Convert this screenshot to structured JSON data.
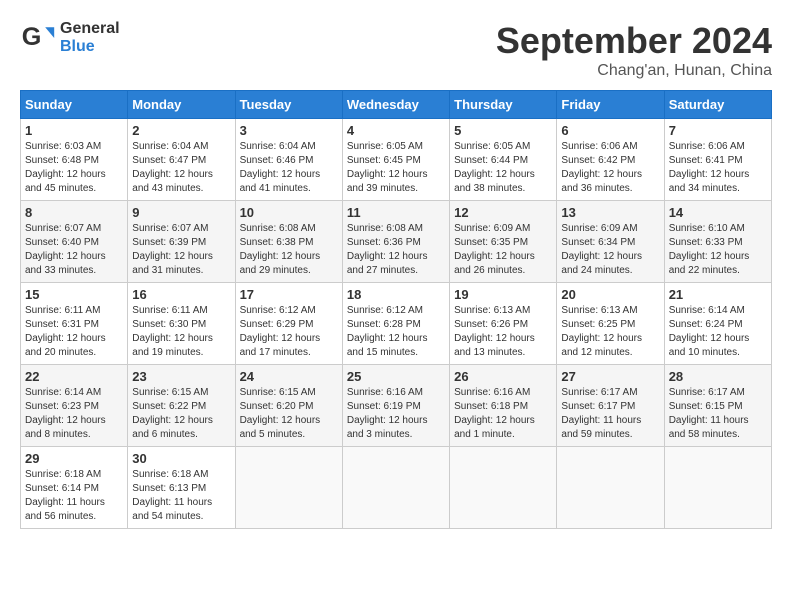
{
  "header": {
    "logo": {
      "line1": "General",
      "line2": "Blue"
    },
    "month": "September 2024",
    "location": "Chang'an, Hunan, China"
  },
  "days_of_week": [
    "Sunday",
    "Monday",
    "Tuesday",
    "Wednesday",
    "Thursday",
    "Friday",
    "Saturday"
  ],
  "weeks": [
    [
      {
        "day": 1,
        "sunrise": "6:03 AM",
        "sunset": "6:48 PM",
        "daylight": "12 hours and 45 minutes."
      },
      {
        "day": 2,
        "sunrise": "6:04 AM",
        "sunset": "6:47 PM",
        "daylight": "12 hours and 43 minutes."
      },
      {
        "day": 3,
        "sunrise": "6:04 AM",
        "sunset": "6:46 PM",
        "daylight": "12 hours and 41 minutes."
      },
      {
        "day": 4,
        "sunrise": "6:05 AM",
        "sunset": "6:45 PM",
        "daylight": "12 hours and 39 minutes."
      },
      {
        "day": 5,
        "sunrise": "6:05 AM",
        "sunset": "6:44 PM",
        "daylight": "12 hours and 38 minutes."
      },
      {
        "day": 6,
        "sunrise": "6:06 AM",
        "sunset": "6:42 PM",
        "daylight": "12 hours and 36 minutes."
      },
      {
        "day": 7,
        "sunrise": "6:06 AM",
        "sunset": "6:41 PM",
        "daylight": "12 hours and 34 minutes."
      }
    ],
    [
      {
        "day": 8,
        "sunrise": "6:07 AM",
        "sunset": "6:40 PM",
        "daylight": "12 hours and 33 minutes."
      },
      {
        "day": 9,
        "sunrise": "6:07 AM",
        "sunset": "6:39 PM",
        "daylight": "12 hours and 31 minutes."
      },
      {
        "day": 10,
        "sunrise": "6:08 AM",
        "sunset": "6:38 PM",
        "daylight": "12 hours and 29 minutes."
      },
      {
        "day": 11,
        "sunrise": "6:08 AM",
        "sunset": "6:36 PM",
        "daylight": "12 hours and 27 minutes."
      },
      {
        "day": 12,
        "sunrise": "6:09 AM",
        "sunset": "6:35 PM",
        "daylight": "12 hours and 26 minutes."
      },
      {
        "day": 13,
        "sunrise": "6:09 AM",
        "sunset": "6:34 PM",
        "daylight": "12 hours and 24 minutes."
      },
      {
        "day": 14,
        "sunrise": "6:10 AM",
        "sunset": "6:33 PM",
        "daylight": "12 hours and 22 minutes."
      }
    ],
    [
      {
        "day": 15,
        "sunrise": "6:11 AM",
        "sunset": "6:31 PM",
        "daylight": "12 hours and 20 minutes."
      },
      {
        "day": 16,
        "sunrise": "6:11 AM",
        "sunset": "6:30 PM",
        "daylight": "12 hours and 19 minutes."
      },
      {
        "day": 17,
        "sunrise": "6:12 AM",
        "sunset": "6:29 PM",
        "daylight": "12 hours and 17 minutes."
      },
      {
        "day": 18,
        "sunrise": "6:12 AM",
        "sunset": "6:28 PM",
        "daylight": "12 hours and 15 minutes."
      },
      {
        "day": 19,
        "sunrise": "6:13 AM",
        "sunset": "6:26 PM",
        "daylight": "12 hours and 13 minutes."
      },
      {
        "day": 20,
        "sunrise": "6:13 AM",
        "sunset": "6:25 PM",
        "daylight": "12 hours and 12 minutes."
      },
      {
        "day": 21,
        "sunrise": "6:14 AM",
        "sunset": "6:24 PM",
        "daylight": "12 hours and 10 minutes."
      }
    ],
    [
      {
        "day": 22,
        "sunrise": "6:14 AM",
        "sunset": "6:23 PM",
        "daylight": "12 hours and 8 minutes."
      },
      {
        "day": 23,
        "sunrise": "6:15 AM",
        "sunset": "6:22 PM",
        "daylight": "12 hours and 6 minutes."
      },
      {
        "day": 24,
        "sunrise": "6:15 AM",
        "sunset": "6:20 PM",
        "daylight": "12 hours and 5 minutes."
      },
      {
        "day": 25,
        "sunrise": "6:16 AM",
        "sunset": "6:19 PM",
        "daylight": "12 hours and 3 minutes."
      },
      {
        "day": 26,
        "sunrise": "6:16 AM",
        "sunset": "6:18 PM",
        "daylight": "12 hours and 1 minute."
      },
      {
        "day": 27,
        "sunrise": "6:17 AM",
        "sunset": "6:17 PM",
        "daylight": "11 hours and 59 minutes."
      },
      {
        "day": 28,
        "sunrise": "6:17 AM",
        "sunset": "6:15 PM",
        "daylight": "11 hours and 58 minutes."
      }
    ],
    [
      {
        "day": 29,
        "sunrise": "6:18 AM",
        "sunset": "6:14 PM",
        "daylight": "11 hours and 56 minutes."
      },
      {
        "day": 30,
        "sunrise": "6:18 AM",
        "sunset": "6:13 PM",
        "daylight": "11 hours and 54 minutes."
      },
      null,
      null,
      null,
      null,
      null
    ]
  ]
}
